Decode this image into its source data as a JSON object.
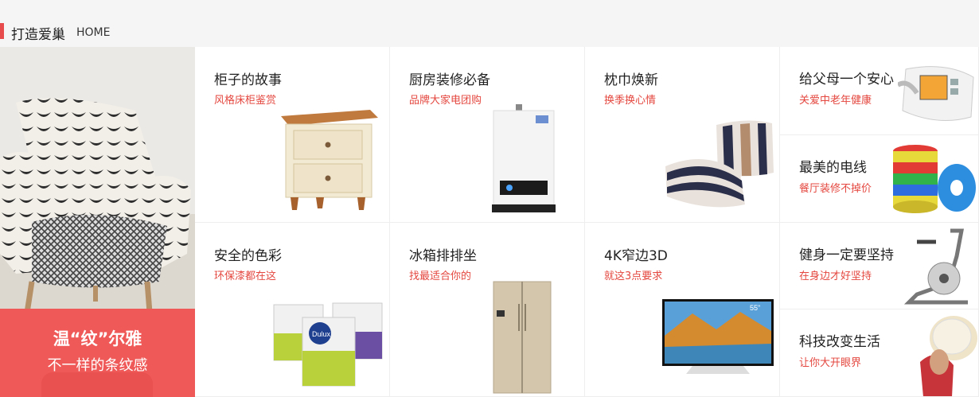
{
  "section": {
    "title": "打造爱巢",
    "subtitle": "HOME"
  },
  "hero": {
    "line1": "温“纹”尔雅",
    "line2": "不一样的条纹感"
  },
  "tiles": [
    {
      "title": "柜子的故事",
      "subtitle": "风格床柜鉴赏",
      "icon": "nightstand-image"
    },
    {
      "title": "厨房装修必备",
      "subtitle": "品牌大家电团购",
      "icon": "water-heater-image"
    },
    {
      "title": "枕巾焕新",
      "subtitle": "换季换心情",
      "icon": "pillow-image"
    },
    {
      "title": "给父母一个安心",
      "subtitle": "关爱中老年健康",
      "icon": "blood-pressure-monitor-image"
    },
    {
      "title": "最美的电线",
      "subtitle": "餐厅装修不掉价",
      "icon": "cable-reels-image"
    },
    {
      "title": "安全的色彩",
      "subtitle": "环保漆都在这",
      "icon": "paint-buckets-image",
      "brand": "Dulux"
    },
    {
      "title": "冰箱排排坐",
      "subtitle": "找最适合你的",
      "icon": "refrigerator-image"
    },
    {
      "title": "4K窄边3D",
      "subtitle": "就这3点要求",
      "icon": "tv-image",
      "badge": "55\""
    },
    {
      "title": "健身一定要坚持",
      "subtitle": "在身边才好坚持",
      "icon": "exercise-bike-image"
    },
    {
      "title": "科技改变生活",
      "subtitle": "让你大开眼界",
      "icon": "vr-headset-image"
    }
  ],
  "colors": {
    "accent": "#e84b4b",
    "subtitle": "#e4473f",
    "banner": "#ef5a58"
  }
}
